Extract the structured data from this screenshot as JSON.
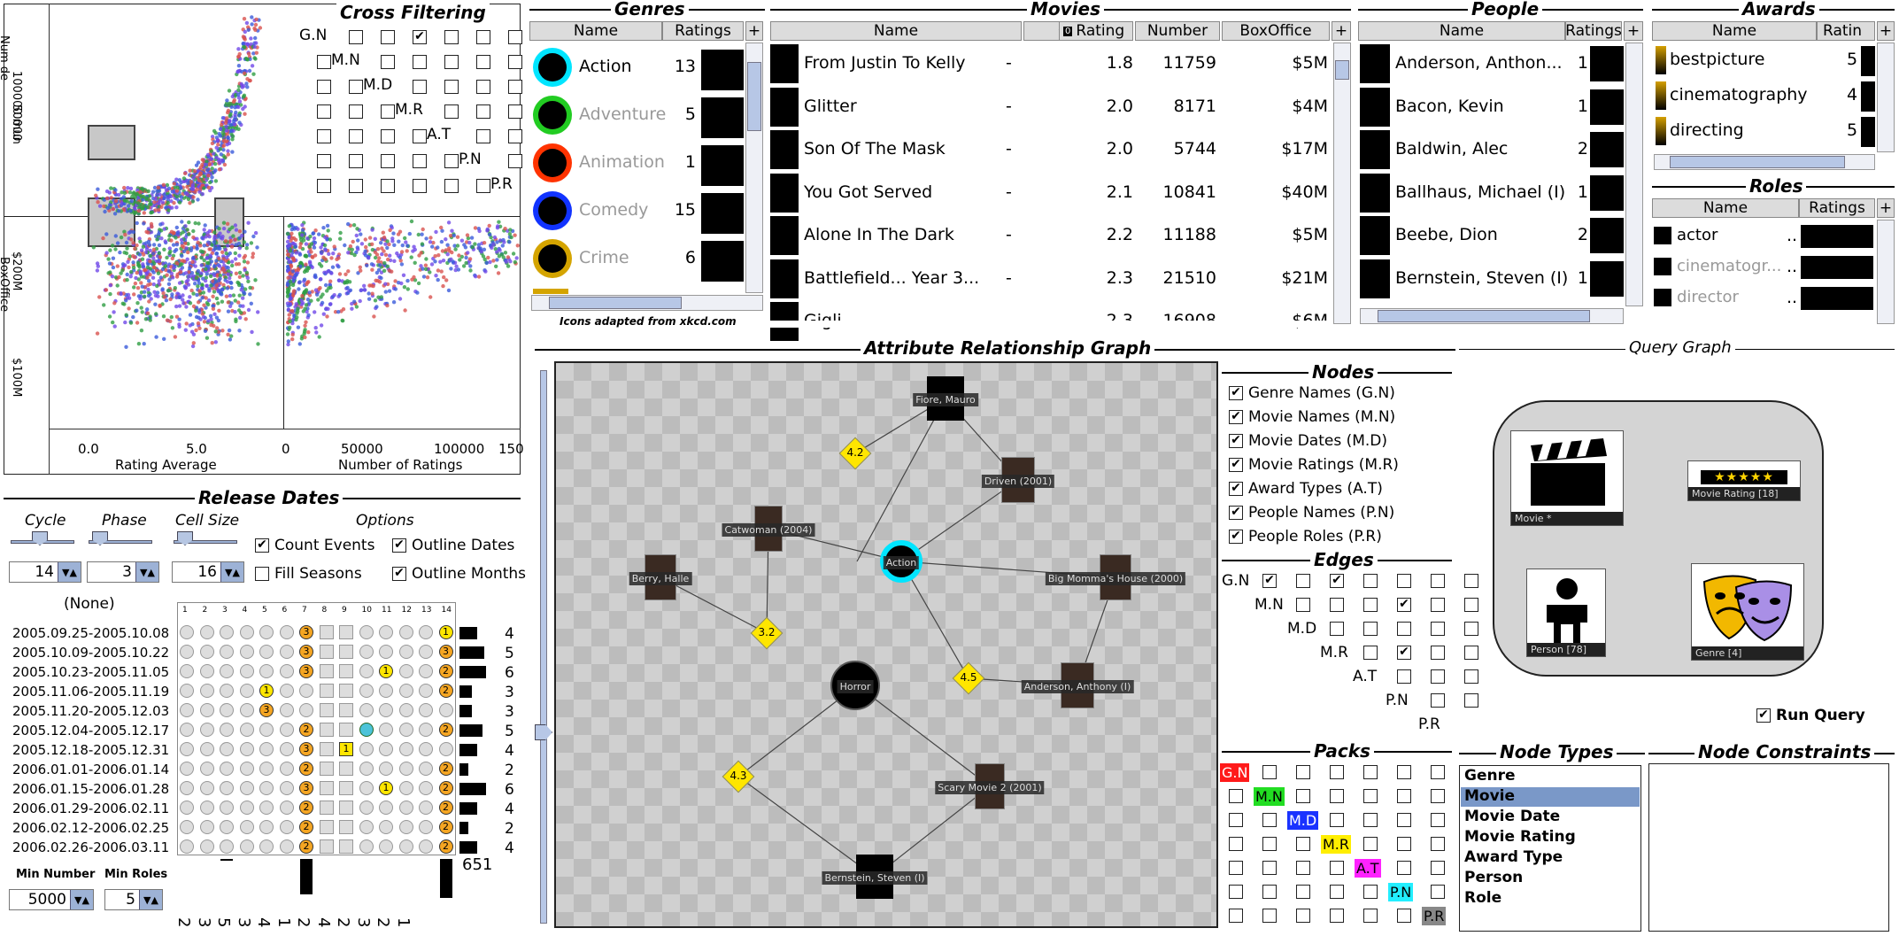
{
  "cross_filtering": {
    "title": "Cross Filtering",
    "labels": [
      "G.N",
      "M.N",
      "M.D",
      "M.R",
      "A.T",
      "P.N",
      "P.R"
    ],
    "checked": [
      [
        0,
        3
      ],
      [
        5,
        5
      ]
    ]
  },
  "scatter": {
    "y_labels_top": [
      "100000 mun",
      "50000"
    ],
    "y_labels_bottom": [
      "$200M",
      "$100M"
    ],
    "y_axis_top_title": "Num de",
    "y_axis_bottom_title": "BoxOffice",
    "x_left_ticks": [
      "0.0",
      "5.0"
    ],
    "x_right_ticks": [
      "0",
      "50000",
      "100000",
      "150"
    ],
    "x_left_title": "Rating Average",
    "x_right_title": "Number of Ratings"
  },
  "release": {
    "title": "Release Dates",
    "cycle_label": "Cycle",
    "phase_label": "Phase",
    "cellsize_label": "Cell Size",
    "options_label": "Options",
    "cycle_value": "14",
    "phase_value": "3",
    "cellsize_value": "16",
    "opt_count_events": "Count Events",
    "opt_fill_seasons": "Fill Seasons",
    "opt_outline_dates": "Outline Dates",
    "opt_outline_months": "Outline Months",
    "none_label": "(None)",
    "col_numbers": [
      "1",
      "2",
      "3",
      "4",
      "5",
      "6",
      "7",
      "8",
      "9",
      "10",
      "11",
      "12",
      "13",
      "14"
    ],
    "rows": [
      {
        "range": "2005.09.25-2005.10.08",
        "count": "4"
      },
      {
        "range": "2005.10.09-2005.10.22",
        "count": "5"
      },
      {
        "range": "2005.10.23-2005.11.05",
        "count": "6"
      },
      {
        "range": "2005.11.06-2005.11.19",
        "count": "3"
      },
      {
        "range": "2005.11.20-2005.12.03",
        "count": "3"
      },
      {
        "range": "2005.12.04-2005.12.17",
        "count": "5"
      },
      {
        "range": "2005.12.18-2005.12.31",
        "count": "4"
      },
      {
        "range": "2006.01.01-2006.01.14",
        "count": "2"
      },
      {
        "range": "2006.01.15-2006.01.28",
        "count": "6"
      },
      {
        "range": "2006.01.29-2006.02.11",
        "count": "4"
      },
      {
        "range": "2006.02.12-2006.02.25",
        "count": "2"
      },
      {
        "range": "2006.02.26-2006.03.11",
        "count": "4"
      }
    ],
    "bottom_total": "651",
    "bottom_digits": [
      "2",
      "3",
      "5",
      "3",
      "4",
      "1",
      "2",
      "4",
      "2",
      "3",
      "2",
      "1"
    ],
    "min_number_label": "Min Number",
    "min_roles_label": "Min Roles",
    "min_number_value": "5000",
    "min_roles_value": "5"
  },
  "genres": {
    "title": "Genres",
    "col_name": "Name",
    "col_ratings": "Ratings",
    "items": [
      {
        "name": "Action",
        "ratings": "13",
        "color": "#00e5ff"
      },
      {
        "name": "Adventure",
        "ratings": "5",
        "color": "#22cc22"
      },
      {
        "name": "Animation",
        "ratings": "1",
        "color": "#ff3300"
      },
      {
        "name": "Comedy",
        "ratings": "15",
        "color": "#1133ff"
      },
      {
        "name": "Crime",
        "ratings": "6",
        "color": "#d4a400"
      }
    ],
    "credit": "Icons adapted from xkcd.com"
  },
  "movies": {
    "title": "Movies",
    "cols": [
      "Name",
      "Clip",
      "Rating",
      "Number",
      "BoxOffice"
    ],
    "rows": [
      {
        "name": "From Justin To Kelly",
        "clip": "-",
        "rating": "1.8",
        "number": "11759",
        "box": "$5M"
      },
      {
        "name": "Glitter",
        "clip": "-",
        "rating": "2.0",
        "number": "8171",
        "box": "$4M"
      },
      {
        "name": "Son Of The Mask",
        "clip": "-",
        "rating": "2.0",
        "number": "5744",
        "box": "$17M"
      },
      {
        "name": "You Got Served",
        "clip": "-",
        "rating": "2.1",
        "number": "10841",
        "box": "$40M"
      },
      {
        "name": "Alone In The Dark",
        "clip": "-",
        "rating": "2.2",
        "number": "11188",
        "box": "$5M"
      },
      {
        "name": "Battlefield... Year 3...",
        "clip": "-",
        "rating": "2.3",
        "number": "21510",
        "box": "$21M"
      },
      {
        "name": "Gigli",
        "clip": "-",
        "rating": "2.3",
        "number": "16908",
        "box": "$6M"
      }
    ]
  },
  "people": {
    "title": "People",
    "col_name": "Name",
    "col_ratings": "Ratings",
    "rows": [
      {
        "name": "Anderson, Anthon...",
        "ratings": "1"
      },
      {
        "name": "Bacon, Kevin",
        "ratings": "1"
      },
      {
        "name": "Baldwin, Alec",
        "ratings": "2"
      },
      {
        "name": "Ballhaus, Michael (I)",
        "ratings": "1"
      },
      {
        "name": "Beebe, Dion",
        "ratings": "2"
      },
      {
        "name": "Bernstein, Steven (I)",
        "ratings": "1"
      }
    ]
  },
  "awards": {
    "title": "Awards",
    "col_name": "Name",
    "col_ratings": "Ratin",
    "rows": [
      {
        "name": "bestpicture",
        "ratings": "5"
      },
      {
        "name": "cinematography",
        "ratings": "4"
      },
      {
        "name": "directing",
        "ratings": "5"
      }
    ]
  },
  "roles": {
    "title": "Roles",
    "col_name": "Name",
    "col_ratings": "Ratings",
    "rows": [
      {
        "name": "actor",
        "dots": ".."
      },
      {
        "name": "cinematogr...",
        "dots": ".."
      },
      {
        "name": "director",
        "dots": ".."
      }
    ]
  },
  "arg": {
    "title": "Attribute Relationship Graph",
    "nodes": [
      {
        "label": "Fiore, Mauro"
      },
      {
        "label": "Driven (2001)"
      },
      {
        "label": "Catwoman (2004)"
      },
      {
        "label": "Action"
      },
      {
        "label": "Berry, Halle"
      },
      {
        "label": "Big Momma's House (2000)"
      },
      {
        "label": "Horror"
      },
      {
        "label": "Anderson, Anthony (I)"
      },
      {
        "label": "Scary Movie 2 (2001)"
      },
      {
        "label": "Bernstein, Steven (I)"
      }
    ],
    "diamonds": [
      "4.2",
      "3.2",
      "4.5",
      "4.3"
    ]
  },
  "nodes_panel": {
    "title": "Nodes",
    "items": [
      "Genre Names (G.N)",
      "Movie Names (M.N)",
      "Movie Dates (M.D)",
      "Movie Ratings (M.R)",
      "Award Types (A.T)",
      "People Names (P.N)",
      "People Roles (P.R)"
    ]
  },
  "edges_panel": {
    "title": "Edges",
    "labels": [
      "G.N",
      "M.N",
      "M.D",
      "M.R",
      "A.T",
      "P.N",
      "P.R"
    ]
  },
  "packs_panel": {
    "title": "Packs",
    "labels": [
      "G.N",
      "M.N",
      "M.D",
      "M.R",
      "A.T",
      "P.N",
      "P.R"
    ],
    "colors": [
      "#ff1a1a",
      "#22dd22",
      "#1a33ff",
      "#ffee00",
      "#ff22ff",
      "#22eeff",
      "#888888"
    ]
  },
  "query_graph": {
    "title": "Query Graph",
    "movie_label": "Movie *",
    "rating_label": "Movie Rating [18]",
    "person_label": "Person [78]",
    "genre_label": "Genre [4]",
    "run_query": "Run Query"
  },
  "node_types": {
    "title": "Node Types",
    "items": [
      "Genre",
      "Movie",
      "Movie Date",
      "Movie Rating",
      "Award Type",
      "Person",
      "Role"
    ],
    "selected": "Movie"
  },
  "node_constraints": {
    "title": "Node Constraints"
  }
}
